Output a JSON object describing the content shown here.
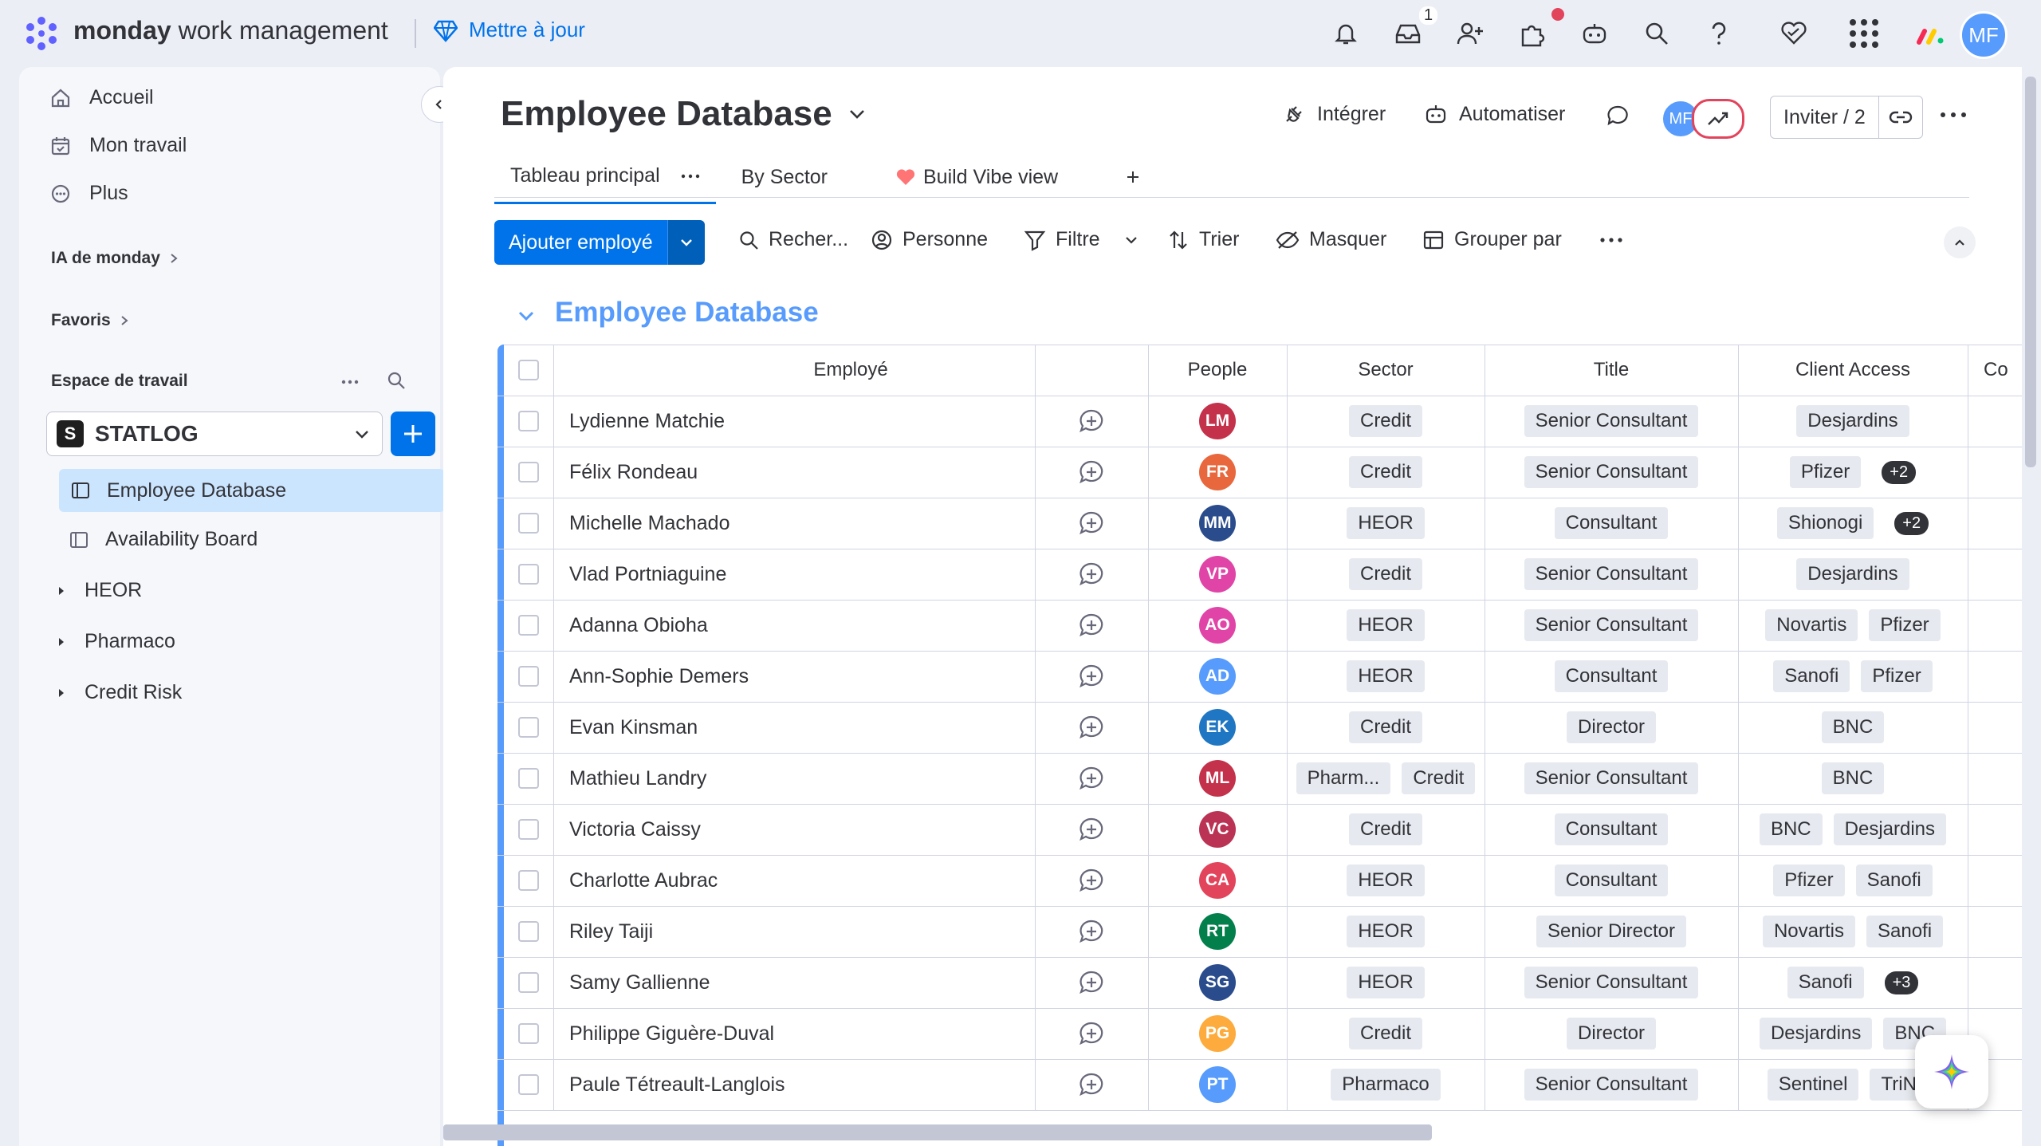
{
  "topbar": {
    "brand_bold": "monday",
    "brand_rest": " work management",
    "upgrade_label": "Mettre à jour",
    "inbox_count": "1",
    "user_initials": "MF"
  },
  "sidebar": {
    "nav": [
      {
        "label": "Accueil"
      },
      {
        "label": "Mon travail"
      },
      {
        "label": "Plus"
      }
    ],
    "ai_label": "IA de monday",
    "favorites_label": "Favoris",
    "workspace_label": "Espace de travail",
    "workspace_name": "STATLOG",
    "boards": [
      {
        "label": "Employee Database"
      },
      {
        "label": "Availability Board"
      }
    ],
    "folders": [
      {
        "label": "HEOR"
      },
      {
        "label": "Pharmaco"
      },
      {
        "label": "Credit Risk"
      }
    ]
  },
  "board": {
    "title": "Employee Database",
    "integrate_label": "Intégrer",
    "automate_label": "Automatiser",
    "invite_label": "Inviter / 2",
    "avatar_initials": "MF",
    "tabs": [
      {
        "label": "Tableau principal"
      },
      {
        "label": "By Sector"
      },
      {
        "label": "Build Vibe view"
      }
    ],
    "add_button": "Ajouter employé",
    "toolbar": {
      "search": "Recher...",
      "person": "Personne",
      "filter": "Filtre",
      "sort": "Trier",
      "hide": "Masquer",
      "group": "Grouper par"
    },
    "group_title": "Employee Database",
    "columns": {
      "employee": "Employé",
      "people": "People",
      "sector": "Sector",
      "title": "Title",
      "client": "Client Access",
      "next": "Co"
    },
    "rows": [
      {
        "name": "Lydienne Matchie",
        "initials": "LM",
        "color": "#c4314b",
        "sector": [
          "Credit"
        ],
        "title": "Senior Consultant",
        "clients": [
          "Desjardins"
        ],
        "more": ""
      },
      {
        "name": "Félix Rondeau",
        "initials": "FR",
        "color": "#e8673c",
        "sector": [
          "Credit"
        ],
        "title": "Senior Consultant",
        "clients": [
          "Pfizer"
        ],
        "more": "+2"
      },
      {
        "name": "Michelle Machado",
        "initials": "MM",
        "color": "#2b4c8c",
        "sector": [
          "HEOR"
        ],
        "title": "Consultant",
        "clients": [
          "Shionogi"
        ],
        "more": "+2"
      },
      {
        "name": "Vlad Portniaguine",
        "initials": "VP",
        "color": "#e044a7",
        "sector": [
          "Credit"
        ],
        "title": "Senior Consultant",
        "clients": [
          "Desjardins"
        ],
        "more": ""
      },
      {
        "name": "Adanna Obioha",
        "initials": "AO",
        "color": "#e044a7",
        "sector": [
          "HEOR"
        ],
        "title": "Senior Consultant",
        "clients": [
          "Novartis",
          "Pfizer"
        ],
        "more": ""
      },
      {
        "name": "Ann-Sophie Demers",
        "initials": "AD",
        "color": "#579bfc",
        "sector": [
          "HEOR"
        ],
        "title": "Consultant",
        "clients": [
          "Sanofi",
          "Pfizer"
        ],
        "more": ""
      },
      {
        "name": "Evan Kinsman",
        "initials": "EK",
        "color": "#1f76c2",
        "sector": [
          "Credit"
        ],
        "title": "Director",
        "clients": [
          "BNC"
        ],
        "more": ""
      },
      {
        "name": "Mathieu Landry",
        "initials": "ML",
        "color": "#c4314b",
        "sector": [
          "Pharm...",
          "Credit"
        ],
        "title": "Senior Consultant",
        "clients": [
          "BNC"
        ],
        "more": ""
      },
      {
        "name": "Victoria Caissy",
        "initials": "VC",
        "color": "#bb3354",
        "sector": [
          "Credit"
        ],
        "title": "Consultant",
        "clients": [
          "BNC",
          "Desjardins"
        ],
        "more": ""
      },
      {
        "name": "Charlotte Aubrac",
        "initials": "CA",
        "color": "#e2445c",
        "sector": [
          "HEOR"
        ],
        "title": "Consultant",
        "clients": [
          "Pfizer",
          "Sanofi"
        ],
        "more": ""
      },
      {
        "name": "Riley Taiji",
        "initials": "RT",
        "color": "#037f4c",
        "sector": [
          "HEOR"
        ],
        "title": "Senior Director",
        "clients": [
          "Novartis",
          "Sanofi"
        ],
        "more": ""
      },
      {
        "name": "Samy Gallienne",
        "initials": "SG",
        "color": "#2b4c8c",
        "sector": [
          "HEOR"
        ],
        "title": "Senior Consultant",
        "clients": [
          "Sanofi"
        ],
        "more": "+3"
      },
      {
        "name": "Philippe Giguère-Duval",
        "initials": "PG",
        "color": "#fdab3d",
        "sector": [
          "Credit"
        ],
        "title": "Director",
        "clients": [
          "Desjardins",
          "BNC"
        ],
        "more": ""
      },
      {
        "name": "Paule Tétreault-Langlois",
        "initials": "PT",
        "color": "#579bfc",
        "sector": [
          "Pharmaco"
        ],
        "title": "Senior Consultant",
        "clients": [
          "Sentinel",
          "TriNe"
        ],
        "more": ""
      }
    ]
  }
}
